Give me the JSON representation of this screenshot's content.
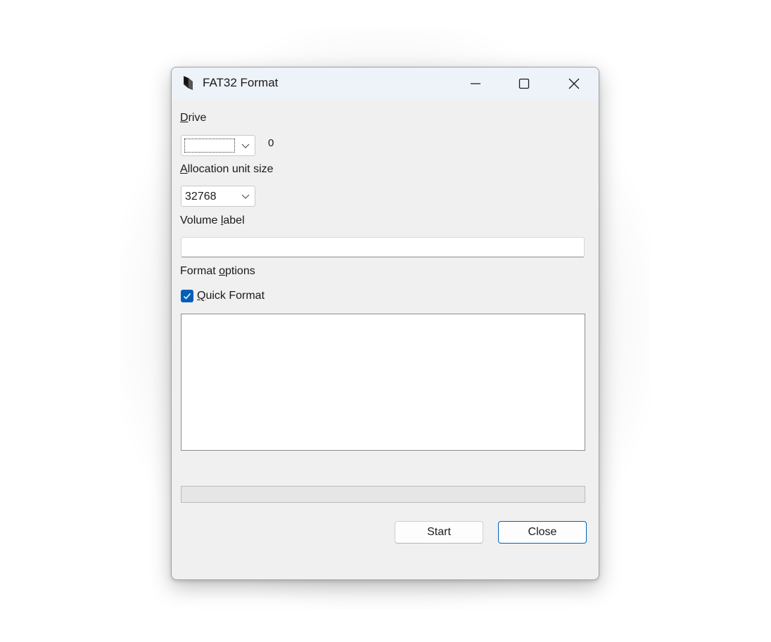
{
  "window": {
    "title": "FAT32 Format",
    "app_icon": "fat32format-app-icon",
    "controls": {
      "minimize_icon": "minimize-icon",
      "maximize_icon": "maximize-icon",
      "close_icon": "close-icon"
    }
  },
  "drive": {
    "label_accel": "D",
    "label_rest": "rive",
    "selected_value": "",
    "count_text": "0"
  },
  "allocation": {
    "label_accel": "A",
    "label_rest": "llocation unit size",
    "selected_value": "32768"
  },
  "volume_label": {
    "label_pre": "Volume ",
    "label_accel": "l",
    "label_post": "abel",
    "value": ""
  },
  "format_options": {
    "label_pre": "Format ",
    "label_accel": "o",
    "label_post": "ptions",
    "quick_format": {
      "accel": "Q",
      "rest": "uick Format",
      "checked": true
    }
  },
  "log": {
    "text": ""
  },
  "progress": {
    "percent": 0
  },
  "buttons": {
    "start_label": "Start",
    "close_label": "Close"
  },
  "colors": {
    "accent": "#005fb8",
    "window_bg": "#f0f0f0",
    "titlebar_bg": "#eef2f9"
  }
}
